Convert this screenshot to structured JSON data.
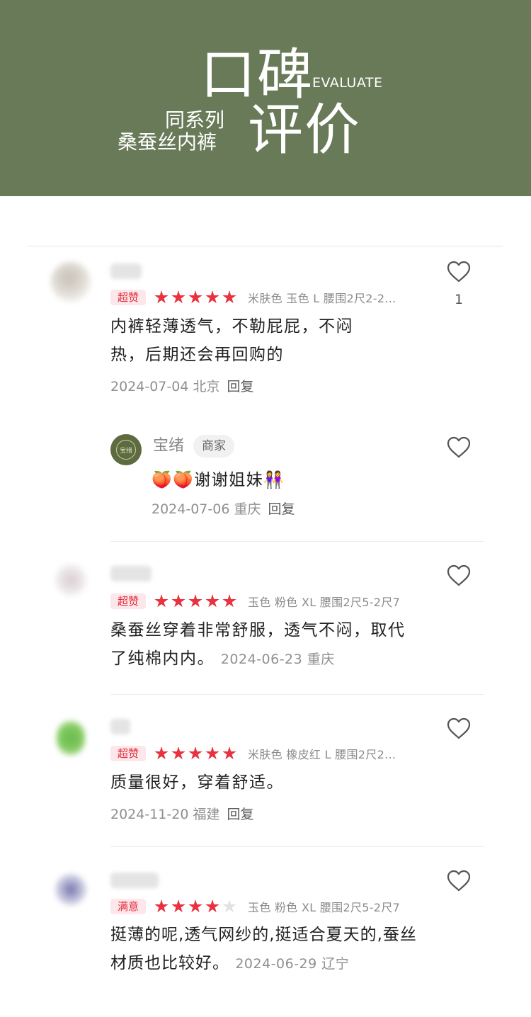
{
  "banner": {
    "title1": "口碑",
    "title_en": "EVALUATE",
    "subtitle1": "同系列",
    "subtitle2": "桑蚕丝内裤",
    "title2": "评价",
    "background": "#687a57"
  },
  "colors": {
    "star": "#e8323f",
    "tag_bg": "#fde7ea",
    "tag_text": "#e02e3d"
  },
  "reviews": [
    {
      "tag": "超赞",
      "rating": 5,
      "spec": "米肤色 玉色 L 腰围2尺2-2…",
      "content": "内裤轻薄透气，不勒屁屁，不闷热，后期还会再回购的",
      "meta": "2024-07-04 北京",
      "reply": "回复",
      "likes": "1"
    },
    {
      "tag": "超赞",
      "rating": 5,
      "spec": "玉色 粉色 XL 腰围2尺5-2尺7",
      "content": "桑蚕丝穿着非常舒服，透气不闷，取代了纯棉内内。",
      "meta": "2024-06-23 重庆"
    },
    {
      "tag": "超赞",
      "rating": 5,
      "spec": "米肤色 橡皮红 L 腰围2尺2…",
      "content": "质量很好，穿着舒适。",
      "meta": "2024-11-20 福建",
      "reply": "回复"
    },
    {
      "tag": "满意",
      "rating": 4,
      "spec": "玉色 粉色 XL 腰围2尺5-2尺7",
      "content": "挺薄的呢,透气网纱的,挺适合夏天的,蚕丝材质也比较好。",
      "meta": "2024-06-29 辽宁"
    }
  ],
  "seller_reply": {
    "avatar_text": "宝绪",
    "name": "宝绪",
    "badge": "商家",
    "content": "🍑🍑谢谢姐妹👭",
    "meta": "2024-07-06 重庆",
    "reply": "回复"
  },
  "icons": {
    "like": "heart-outline-icon"
  }
}
